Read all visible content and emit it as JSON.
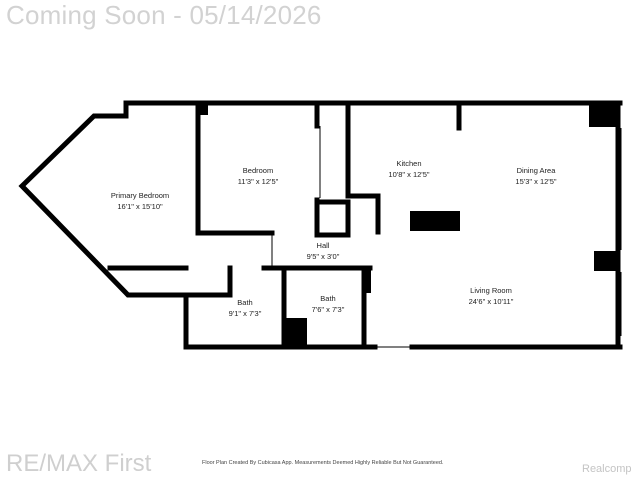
{
  "header": {
    "watermark": "Coming Soon - 05/14/2026"
  },
  "footer": {
    "brand": "RE/MAX First",
    "disclaimer": "Floor Plan Created By Cubicasa App. Measurements Deemed Highly Reliable But Not Guaranteed.",
    "provider": "Realcomp"
  },
  "rooms": {
    "primary_bedroom": {
      "name": "Primary Bedroom",
      "size": "16'1\" x 15'10\""
    },
    "bedroom": {
      "name": "Bedroom",
      "size": "11'3\" x 12'5\""
    },
    "kitchen": {
      "name": "Kitchen",
      "size": "10'8\" x 12'5\""
    },
    "dining_area": {
      "name": "Dining Area",
      "size": "15'3\" x 12'5\""
    },
    "hall": {
      "name": "Hall",
      "size": "9'5\" x 3'0\""
    },
    "living_room": {
      "name": "Living Room",
      "size": "24'6\" x 10'11\""
    },
    "bath_1": {
      "name": "Bath",
      "size": "9'1\" x 7'3\""
    },
    "bath_2": {
      "name": "Bath",
      "size": "7'6\" x 7'3\""
    }
  }
}
